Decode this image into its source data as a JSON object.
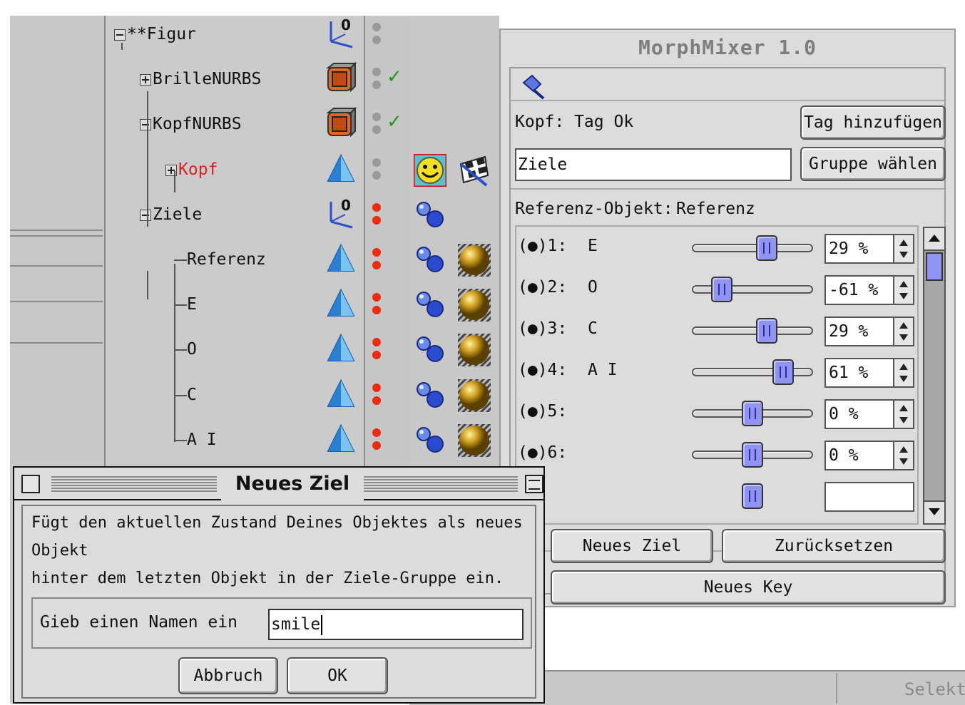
{
  "tree": {
    "items": [
      {
        "label": "**Figur",
        "expander": "minus",
        "color": "#111111",
        "icon": "null-axis-icon",
        "dots": "gray",
        "check": false,
        "tag": null
      },
      {
        "label": "BrilleNURBS",
        "expander": "plus",
        "color": "#111111",
        "icon": "nurbs-cube-icon",
        "dots": "gray",
        "check": true,
        "tag": null
      },
      {
        "label": "KopfNURBS",
        "expander": "minus",
        "color": "#111111",
        "icon": "nurbs-cube-icon",
        "dots": "gray",
        "check": true,
        "tag": null
      },
      {
        "label": "Kopf",
        "expander": "plus",
        "color": "#e02020",
        "icon": "polygon-object-icon",
        "dots": "gray",
        "check": false,
        "tag": "smiley-morph-tag-icon"
      },
      {
        "label": "Ziele",
        "expander": "minus",
        "color": "#111111",
        "icon": "null-axis-icon",
        "dots": "red",
        "check": false,
        "tag": "morph-target-icon"
      },
      {
        "label": "Referenz",
        "expander": null,
        "color": "#111111",
        "icon": "polygon-object-icon",
        "dots": "red",
        "check": false,
        "tag": "morph-target-icon"
      },
      {
        "label": "E",
        "expander": null,
        "color": "#111111",
        "icon": "polygon-object-icon",
        "dots": "red",
        "check": false,
        "tag": "morph-target-icon"
      },
      {
        "label": "O",
        "expander": null,
        "color": "#111111",
        "icon": "polygon-object-icon",
        "dots": "red",
        "check": false,
        "tag": "morph-target-icon"
      },
      {
        "label": "C",
        "expander": null,
        "color": "#111111",
        "icon": "polygon-object-icon",
        "dots": "red",
        "check": false,
        "tag": "morph-target-icon"
      },
      {
        "label": "A I",
        "expander": null,
        "color": "#111111",
        "icon": "polygon-object-icon",
        "dots": "red",
        "check": false,
        "tag": "morph-target-icon"
      }
    ]
  },
  "statusbar": {
    "text": "Selekti"
  },
  "morphmixer": {
    "title": "MorphMixer 1.0",
    "pin_icon": "pin-icon",
    "status": "Kopf: Tag Ok",
    "add_tag_label": "Tag hinzufügen",
    "group_field_value": "Ziele",
    "choose_group_label": "Gruppe wählen",
    "reference_label": "Referenz-Objekt:",
    "reference_value": "Referenz",
    "morphs": [
      {
        "label": "(●)1:",
        "name": "E",
        "value_text": "29 %",
        "value": 29
      },
      {
        "label": "(●)2:",
        "name": "O",
        "value_text": "-61 %",
        "value": -61
      },
      {
        "label": "(●)3:",
        "name": "C",
        "value_text": "29 %",
        "value": 29
      },
      {
        "label": "(●)4:",
        "name": "A I",
        "value_text": "61 %",
        "value": 61
      },
      {
        "label": "(●)5:",
        "name": "",
        "value_text": "0 %",
        "value": 0
      },
      {
        "label": "(●)6:",
        "name": "",
        "value_text": "0 %",
        "value": 0
      }
    ],
    "new_target_label": "Neues Ziel",
    "reset_label": "Zurücksetzen",
    "new_key_label": "Neues Key"
  },
  "dialog": {
    "title": "Neues Ziel",
    "description": "Fügt den aktuellen Zustand Deines Objektes als neues Objekt\nhinter dem letzten Objekt in der Ziele-Gruppe ein.",
    "prompt": "Gieb einen Namen ein",
    "input_value": "smile",
    "cancel_label": "Abbruch",
    "ok_label": "OK"
  },
  "colors": {
    "dot_gray": "#9a9a9a",
    "dot_red": "#ee2a10",
    "slider_thumb": "#8f94f0",
    "check_green": "#1a9a1a"
  }
}
